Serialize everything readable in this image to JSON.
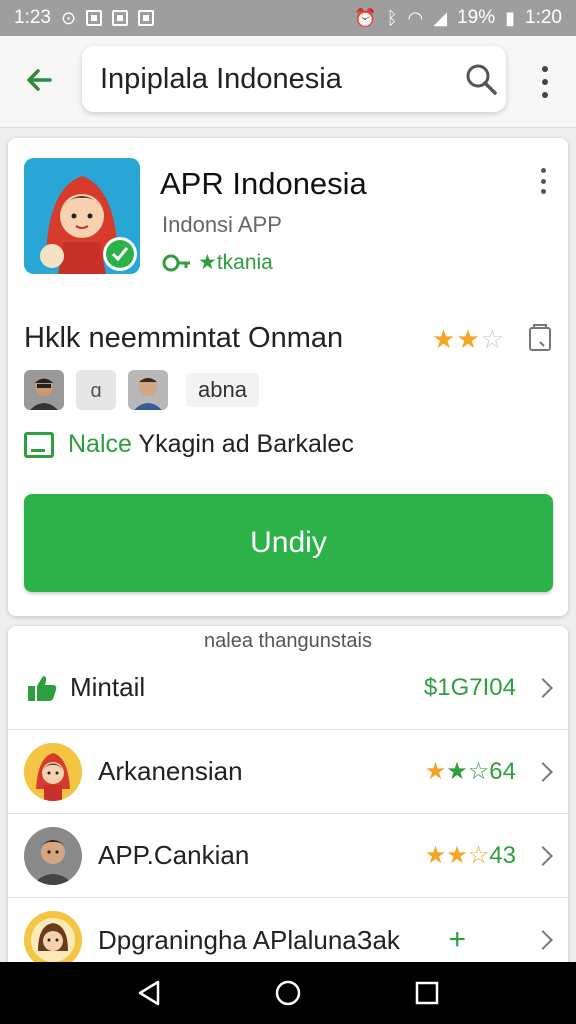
{
  "status_bar": {
    "time_left": "1:23",
    "battery": "19%",
    "time_right": "1:20"
  },
  "search": {
    "query": "Inpiplala Indonesia"
  },
  "app": {
    "title": "APR Indonesia",
    "developer": "Indonsi APP",
    "badge": "★tkania",
    "tagline": "Hklk neemmintat Onman",
    "rating_stars": 2,
    "reviewer_tag": "abna",
    "promo_highlight": "Nalce",
    "promo_rest": " Ykagin ad Barkalec",
    "install_label": "Undiy"
  },
  "list": {
    "header": "nalea thangunstais",
    "rows": [
      {
        "label": "Mintail",
        "value": "$1G7I04",
        "icon": "thumbs-up-icon"
      },
      {
        "label": "Arkanensian",
        "value": "★☆64",
        "stars": "★"
      },
      {
        "label": "APP.Cankian",
        "value": "43",
        "stars": "★★☆"
      },
      {
        "label": "Dpgraningha APlalunaЗak",
        "value": "+"
      }
    ]
  },
  "colors": {
    "accent_green": "#2db24a",
    "text_green": "#2e9e3e",
    "star": "#f2a623",
    "status_bar": "#9e9e9e"
  }
}
